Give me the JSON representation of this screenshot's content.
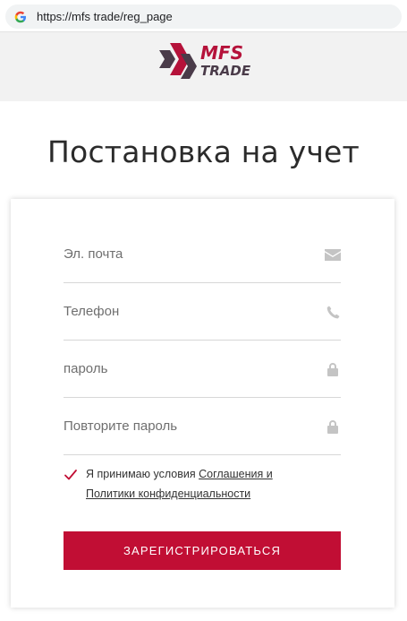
{
  "browser": {
    "url": "https://mfs trade/reg_page"
  },
  "header": {
    "logo_line1": "MFS",
    "logo_line2": "TRADE"
  },
  "page_title": "Постановка на учет",
  "form": {
    "email_placeholder": "Эл. почта",
    "phone_placeholder": "Телефон",
    "password_placeholder": "пароль",
    "repeat_password_placeholder": "Повторите пароль",
    "agree_prefix": "Я принимаю условия ",
    "agree_link1": "Соглашения и",
    "agree_link2": "Политики конфиденциальности",
    "agree_checked": true,
    "submit_label": "ЗАРЕГИСТРИРОВАТЬСЯ"
  },
  "colors": {
    "accent": "#c10e34",
    "logo_dark": "#4a3b49",
    "logo_red": "#b5123a"
  },
  "icons": {
    "email": "envelope-icon",
    "phone": "phone-icon",
    "password": "lock-icon",
    "repeat_password": "lock-icon"
  }
}
